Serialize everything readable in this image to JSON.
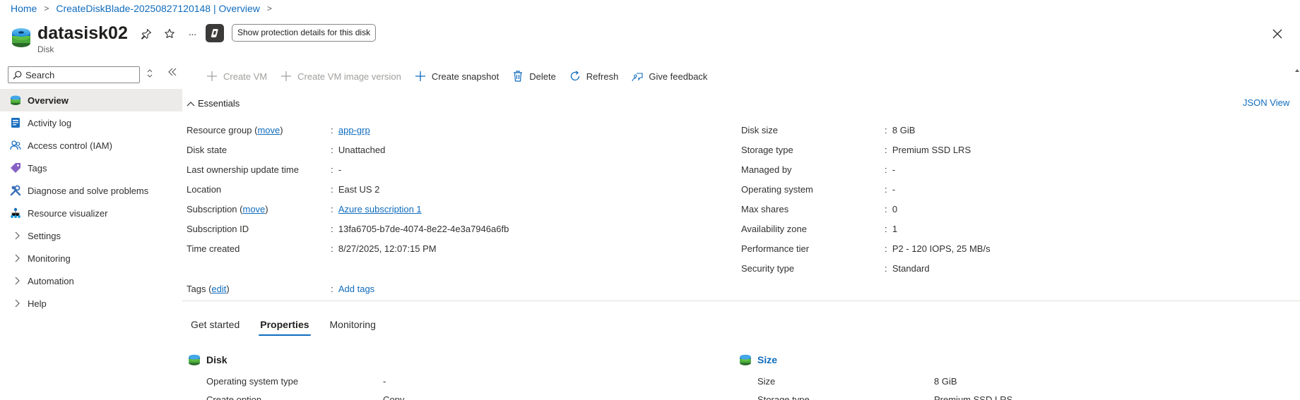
{
  "breadcrumb": {
    "items": [
      "Home",
      "CreateDiskBlade-20250827120148 | Overview"
    ],
    "separator": ">"
  },
  "header": {
    "title": "datasisk02",
    "subtitle": "Disk",
    "more": "···",
    "protection_button": "Show protection details for this disk"
  },
  "sidebar": {
    "search_placeholder": "Search",
    "items": [
      {
        "label": "Overview",
        "icon": "disk-icon",
        "active": true
      },
      {
        "label": "Activity log",
        "icon": "activity-log-icon"
      },
      {
        "label": "Access control (IAM)",
        "icon": "people-icon"
      },
      {
        "label": "Tags",
        "icon": "tag-icon"
      },
      {
        "label": "Diagnose and solve problems",
        "icon": "wrench-icon"
      },
      {
        "label": "Resource visualizer",
        "icon": "hierarchy-icon"
      },
      {
        "label": "Settings",
        "expandable": true
      },
      {
        "label": "Monitoring",
        "expandable": true
      },
      {
        "label": "Automation",
        "expandable": true
      },
      {
        "label": "Help",
        "expandable": true
      }
    ]
  },
  "toolbar": {
    "create_vm": "Create VM",
    "create_vm_image_version": "Create VM image version",
    "create_snapshot": "Create snapshot",
    "delete": "Delete",
    "refresh": "Refresh",
    "give_feedback": "Give feedback"
  },
  "essentials": {
    "title": "Essentials",
    "json_view": "JSON View",
    "colon": ":",
    "left": {
      "resource_group": {
        "label": "Resource group",
        "action": "move",
        "value": "app-grp"
      },
      "disk_state": {
        "label": "Disk state",
        "value": "Unattached"
      },
      "last_ownership": {
        "label": "Last ownership update time",
        "value": "-"
      },
      "location": {
        "label": "Location",
        "value": "East US 2"
      },
      "subscription": {
        "label": "Subscription",
        "action": "move",
        "value": "Azure subscription 1"
      },
      "subscription_id": {
        "label": "Subscription ID",
        "value": "13fa6705-b7de-4074-8e22-4e3a7946a6fb"
      },
      "time_created": {
        "label": "Time created",
        "value": "8/27/2025, 12:07:15 PM"
      }
    },
    "right": [
      {
        "label": "Disk size",
        "value": "8 GiB"
      },
      {
        "label": "Storage type",
        "value": "Premium SSD LRS"
      },
      {
        "label": "Managed by",
        "value": "-"
      },
      {
        "label": "Operating system",
        "value": "-"
      },
      {
        "label": "Max shares",
        "value": "0"
      },
      {
        "label": "Availability zone",
        "value": "1"
      },
      {
        "label": "Performance tier",
        "value": "P2 - 120 IOPS, 25 MB/s"
      },
      {
        "label": "Security type",
        "value": "Standard"
      }
    ],
    "tags": {
      "label": "Tags",
      "action": "edit",
      "value": "Add tags"
    }
  },
  "tabs": [
    "Get started",
    "Properties",
    "Monitoring"
  ],
  "properties": {
    "disk": {
      "title": "Disk",
      "rows": [
        {
          "label": "Operating system type",
          "value": "-"
        },
        {
          "label": "Create option",
          "value": "Copy"
        }
      ]
    },
    "size": {
      "title": "Size",
      "rows": [
        {
          "label": "Size",
          "value": "8 GiB"
        },
        {
          "label": "Storage type",
          "value": "Premium SSD LRS"
        }
      ]
    }
  },
  "colors": {
    "accent": "#0f6cbd",
    "text": "#323130",
    "disabled": "#a19f9d",
    "active_nav_bg": "#edebe9"
  }
}
